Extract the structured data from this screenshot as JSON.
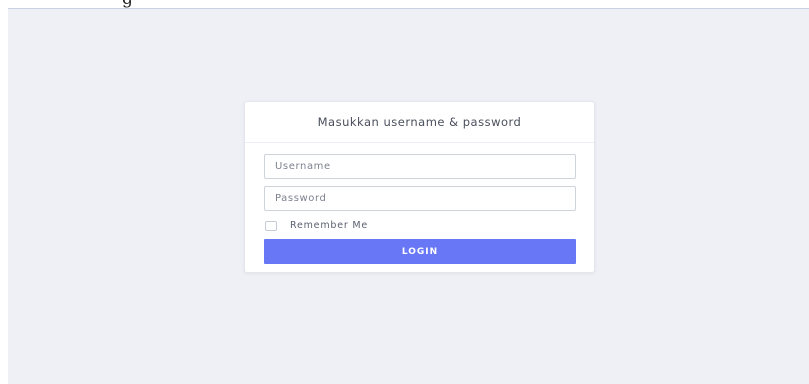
{
  "page": {
    "top_text": "g"
  },
  "login": {
    "title": "Masukkan username & password",
    "username_placeholder": "Username",
    "username_value": "",
    "password_placeholder": "Password",
    "password_value": "",
    "remember_label": "Remember Me",
    "remember_checked": false,
    "submit_label": "LOGIN"
  },
  "colors": {
    "background": "#eef0f6",
    "card": "#ffffff",
    "accent": "#6777f5",
    "input_border": "#cfd3dc"
  }
}
